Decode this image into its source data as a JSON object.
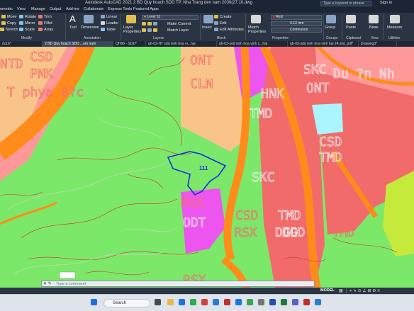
{
  "window": {
    "title": "Autodesk AutoCAD 2021    2 BD Quy hoach SDD TP. Nha Trang den nam 2030(27.10.dwg",
    "search_placeholder": "Type a keyword or phrase",
    "sign_in": "Sign In"
  },
  "menu": [
    "ometric",
    "View",
    "Manage",
    "Output",
    "Add-ins",
    "Collaborate",
    "Express Tools",
    "Featured Apps"
  ],
  "ribbon": {
    "modify": {
      "items": [
        "Move",
        "Rotate",
        "Trim",
        "Copy",
        "Mirror",
        "Fillet",
        "Stretch",
        "Scale",
        "Array"
      ],
      "label": "Modify"
    },
    "annotation": {
      "text": "Text",
      "dimension": "Dimension",
      "linear": "Linear",
      "leader": "Leader",
      "table": "Table",
      "label": "Annotation"
    },
    "layers": {
      "properties": "Layer Properties",
      "current_layer": "Level 51",
      "make_current": "Make Current",
      "match_layer": "Match Layer",
      "label": "Layers"
    },
    "block": {
      "insert": "Insert",
      "create": "Create",
      "edit": "Edit",
      "edit_attributes": "Edit Attributes",
      "label": "Block"
    },
    "properties": {
      "match": "Match Properties",
      "color": "Red",
      "lineweight": "0.13 mm",
      "linetype": "Continuous",
      "label": "Properties"
    },
    "groups": {
      "group": "Group",
      "label": "Groups"
    },
    "clipboard": {
      "paste": "Paste",
      "label": "Clipboard"
    },
    "view": {
      "base": "Base",
      "label": "View"
    },
    "utilities": {
      "measure": "Measure",
      "label": "Utilities"
    }
  },
  "tabs": [
    "dc16*",
    "2 BD Quy hoach SDD ...em nam 2030(27.10*",
    "QH06 - SDD*",
    "qh-02-HT sdd vinh hoa vi...hai 29.01.2024(tem)*",
    "qh-03-sdd vinh hoa vinh c...hai 29.01.2024(tem)*",
    "qh-03-sdd vinh hoa vinh hai 24.xml_pdf*",
    "Drawing3*"
  ],
  "drawing": {
    "labels": [
      "NTD",
      "CSD",
      "PNK",
      "ONT",
      "SKC",
      "Du ?n Nh",
      "T phya B?c",
      "CLN",
      "HNK",
      "ONT",
      "TMD",
      "CSD",
      "TMD",
      "SKC",
      "DGD",
      "RSX",
      "CSD",
      "TMD",
      "CSD",
      "ODT",
      "RSX",
      "DGD",
      "TMD",
      "RSX"
    ],
    "parcel_number": "111"
  },
  "command": {
    "placeholder": "Type a command"
  },
  "status": {
    "model": "MODEL"
  },
  "taskbar": {
    "search": "Search"
  },
  "colors": {
    "green": "#7ce86a",
    "orange": "#ff8c1a",
    "pink": "#ff9999",
    "salmon": "#f26b6b",
    "magenta": "#ee55ee",
    "peach": "#f8c48a",
    "cyan": "#aaf5ff",
    "yellowgreen": "#c5ea3c"
  }
}
